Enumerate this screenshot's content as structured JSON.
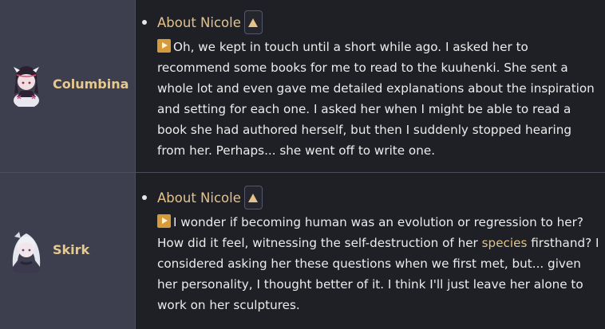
{
  "colors": {
    "name_column_bg": "#3d3f4e",
    "text_column_bg": "#1f1f26",
    "accent_gold": "#e3c38a",
    "play_icon": "#d59b3b",
    "body_text": "#ececec"
  },
  "rows": [
    {
      "character": "Columbina",
      "topic": "About Nicole",
      "toggle_icon": "triangle-up-icon",
      "dialogue": {
        "icon": "play-icon",
        "text": "Oh, we kept in touch until a short while ago. I asked her to recommend some books for me to read to the kuuhenki. She sent a whole lot and even gave me detailed explanations about the inspiration and setting for each one. I asked her when I might be able to read a book she had authored herself, but then I suddenly stopped hearing from her. Perhaps... she went off to write one."
      }
    },
    {
      "character": "Skirk",
      "topic": "About Nicole",
      "toggle_icon": "triangle-up-icon",
      "dialogue": {
        "icon": "play-icon",
        "text_before_link": "I wonder if becoming human was an evolution or regression to her? How did it feel, witnessing the self-destruction of her ",
        "link": "species",
        "text_after_link": " firsthand? I considered asking her these questions when we first met, but... given her personality, I thought better of it. I think I'll just leave her alone to work on her sculptures."
      }
    }
  ]
}
